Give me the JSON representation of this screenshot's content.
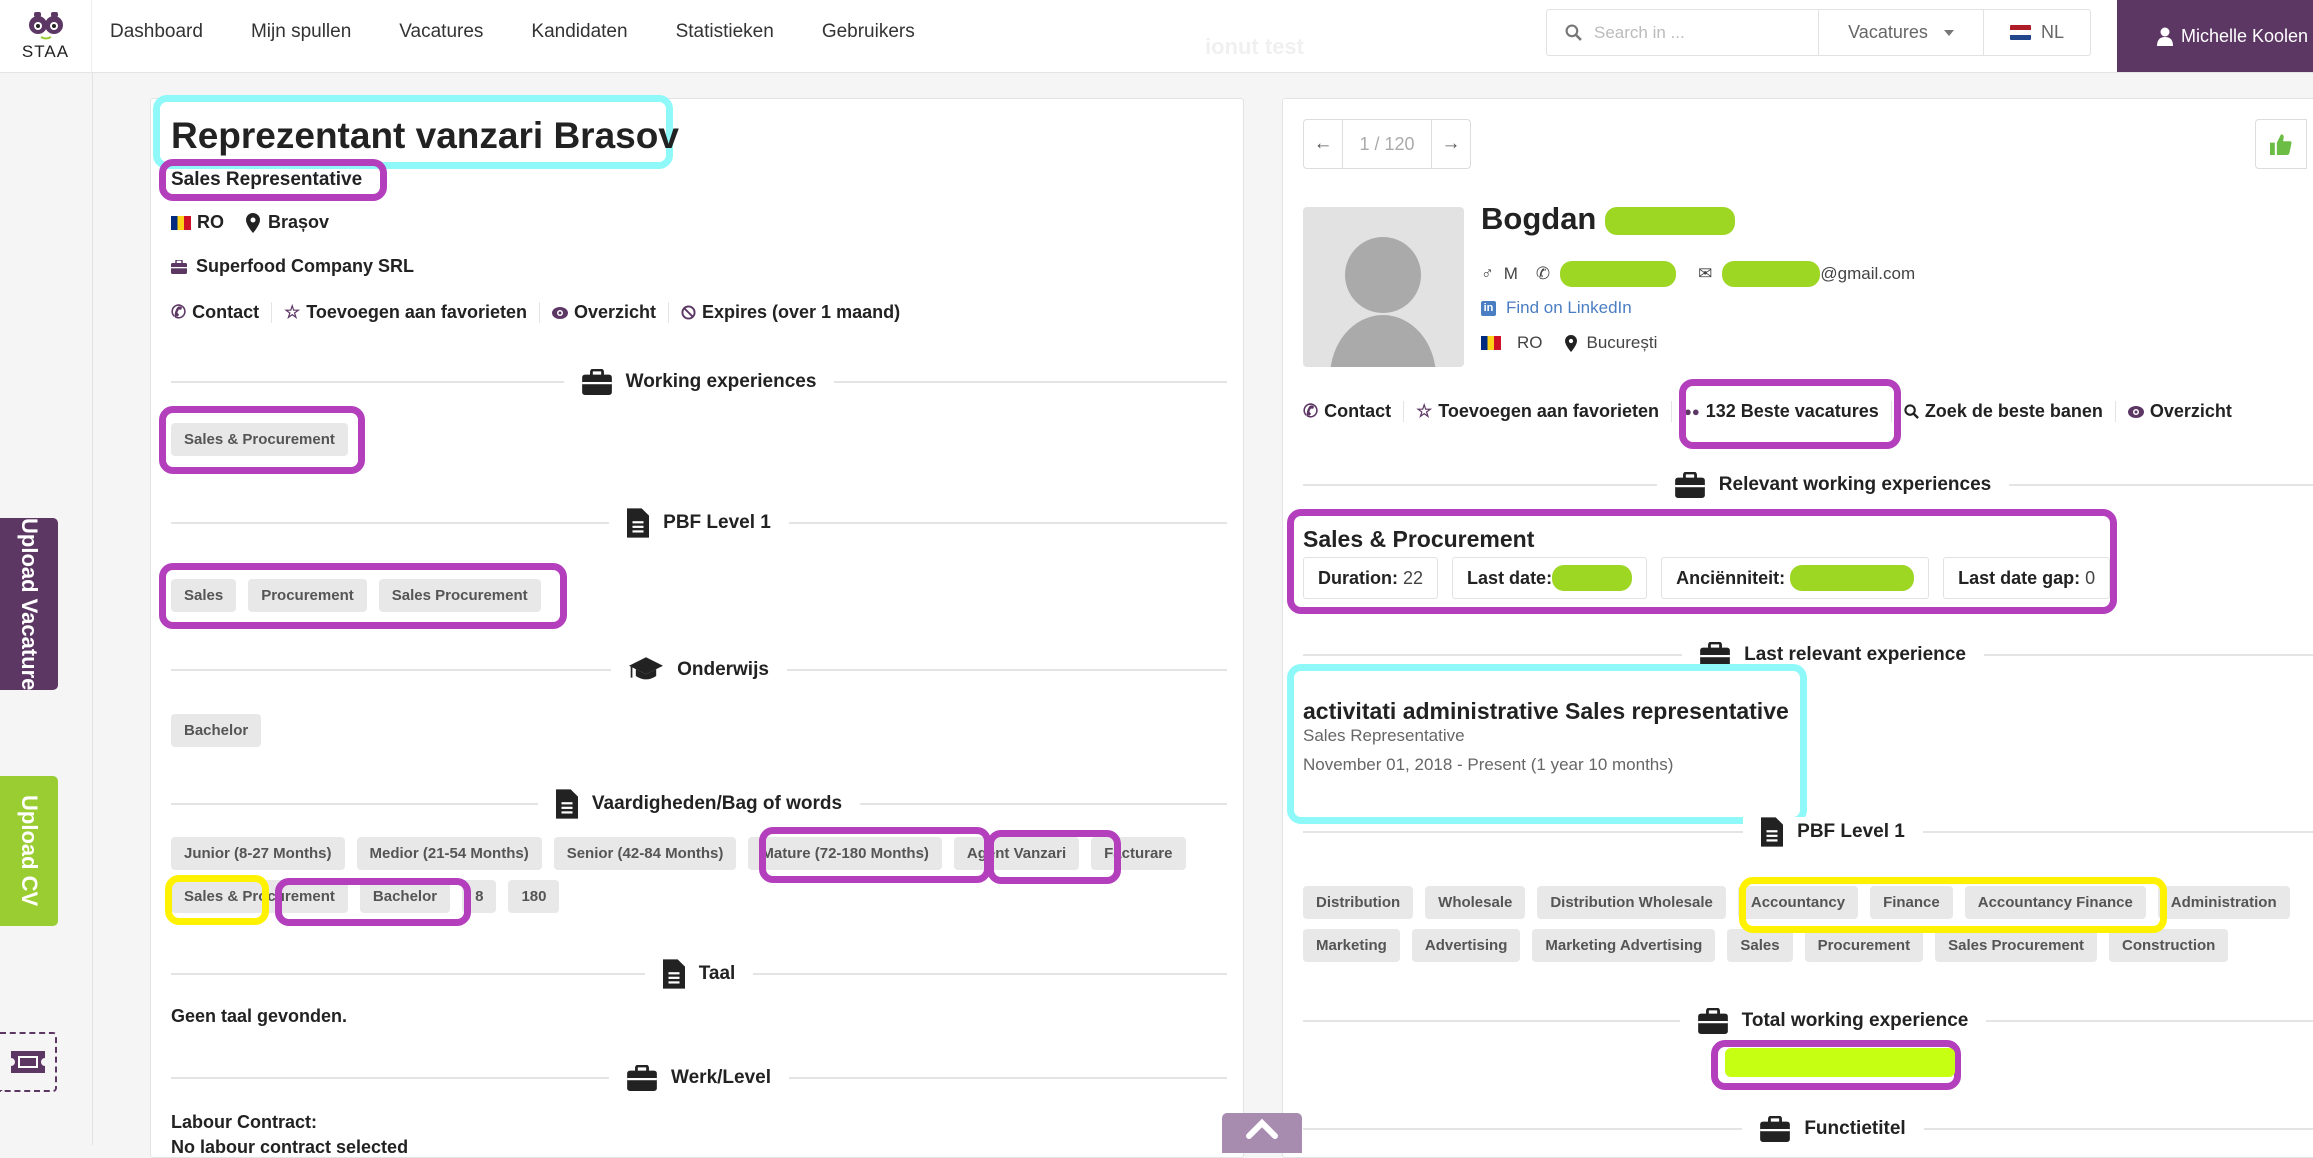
{
  "header": {
    "logo_text": "STAA",
    "nav": [
      "Dashboard",
      "Mijn spullen",
      "Vacatures",
      "Kandidaten",
      "Statistieken",
      "Gebruikers"
    ],
    "ghost_text": "ionut test",
    "search_placeholder": "Search in ...",
    "search_scope": "Vacatures",
    "language": "NL",
    "user_name": "Michelle Koolen"
  },
  "sidebar": {
    "upload_vacature": "Upload Vacature",
    "upload_cv": "Upload CV"
  },
  "vacancy": {
    "title": "Reprezentant vanzari Brasov",
    "subtitle": "Sales Representative",
    "country": "RO",
    "city": "Brașov",
    "company": "Superfood Company SRL",
    "actions": [
      "Contact",
      "Toevoegen aan favorieten",
      "Overzicht",
      "Expires (over 1 maand)"
    ],
    "sections": {
      "working_experiences": {
        "label": "Working experiences",
        "tags": [
          "Sales & Procurement"
        ]
      },
      "pbf": {
        "label": "PBF Level 1",
        "tags": [
          "Sales",
          "Procurement",
          "Sales Procurement"
        ]
      },
      "onderwijs": {
        "label": "Onderwijs",
        "tags": [
          "Bachelor"
        ]
      },
      "vaardigheden": {
        "label": "Vaardigheden/Bag of words",
        "tags": [
          "Junior (8-27 Months)",
          "Medior (21-54 Months)",
          "Senior (42-84 Months)",
          "Mature (72-180 Months)",
          "Agent Vanzari",
          "Facturare",
          "Sales & Procurement",
          "Bachelor",
          "8",
          "180"
        ]
      },
      "taal": {
        "label": "Taal",
        "text": "Geen taal gevonden."
      },
      "werk": {
        "label": "Werk/Level",
        "text": "Labour Contract:",
        "text2": "No labour contract selected"
      }
    }
  },
  "candidate": {
    "pager": "1 / 120",
    "first_name": "Bogdan",
    "gender": "M",
    "email_suffix": "@gmail.com",
    "linkedin": "Find on LinkedIn",
    "country": "RO",
    "city": "București",
    "actions": [
      "Contact",
      "Toevoegen aan favorieten",
      "132 Beste vacatures",
      "Zoek de beste banen",
      "Overzicht"
    ],
    "relevant": {
      "label": "Relevant working experiences",
      "title": "Sales & Procurement",
      "duration_label": "Duration:",
      "duration_value": "22",
      "last_date_label": "Last date:",
      "anciennity_label": "Anciënniteit:",
      "gap_label": "Last date gap:",
      "gap_value": "0"
    },
    "last_experience": {
      "label": "Last relevant experience",
      "title": "activitati administrative Sales representative",
      "subtitle": "Sales Representative",
      "dates": "November 01, 2018  - Present  (1 year 10 months)"
    },
    "pbf": {
      "label": "PBF Level 1",
      "tags": [
        "Distribution",
        "Wholesale",
        "Distribution Wholesale",
        "Accountancy",
        "Finance",
        "Accountancy Finance",
        "Administration",
        "Marketing",
        "Advertising",
        "Marketing Advertising",
        "Sales",
        "Procurement",
        "Sales Procurement",
        "Construction"
      ]
    },
    "total_label": "Total working experience",
    "functie_label": "Functietitel"
  },
  "colors": {
    "brand_purple": "#5c3764",
    "brand_green": "#9acd32",
    "highlight_cyan": "#8ff8f8",
    "highlight_purple": "#b33fbd",
    "highlight_yellow": "#fff200"
  }
}
